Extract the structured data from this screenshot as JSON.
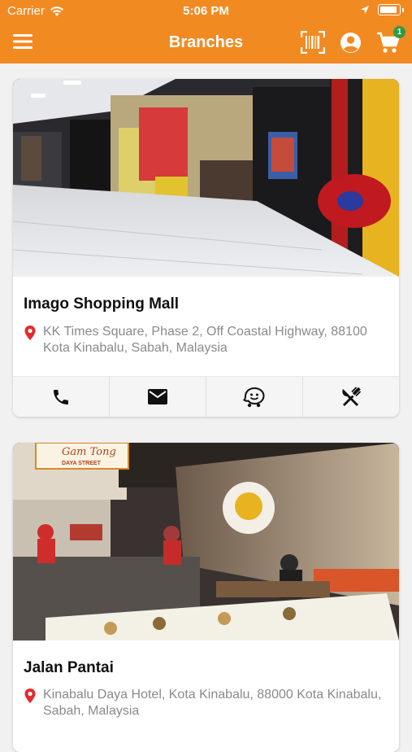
{
  "status": {
    "carrier": "Carrier",
    "time": "5:06 PM"
  },
  "header": {
    "title": "Branches",
    "cart_count": "1"
  },
  "colors": {
    "brand": "#f28a22",
    "badge": "#2e9b44",
    "pin": "#e8282b"
  },
  "branches": [
    {
      "name": "Imago Shopping Mall",
      "address": "KK Times Square, Phase 2, Off Coastal Highway, 88100 Kota Kinabalu, Sabah, Malaysia",
      "actions": [
        "phone-icon",
        "mail-icon",
        "waze-icon",
        "fork-knife-icon"
      ]
    },
    {
      "name": "Jalan Pantai",
      "address": "Kinabalu Daya Hotel, Kota Kinabalu, 88000 Kota Kinabalu, Sabah, Malaysia",
      "sign_text": "Gam Tong",
      "sign_sub": "DAYA STREET"
    }
  ]
}
